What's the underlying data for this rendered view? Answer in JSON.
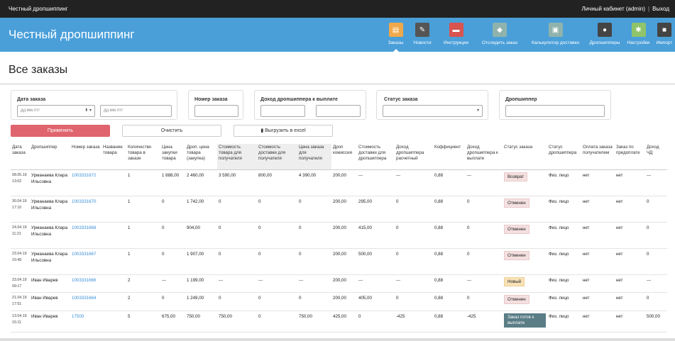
{
  "topbar": {
    "brand": "Честный дропшиппинг",
    "cabinet": "Личный кабинет (admin)",
    "separator": "|",
    "logout": "Выход"
  },
  "header": {
    "title": "Честный дропшиппинг"
  },
  "nav": [
    {
      "label": "Заказы",
      "icon": "orders-icon",
      "color": "#f0a94a",
      "glyph": "▤"
    },
    {
      "label": "Новости",
      "icon": "news-icon",
      "color": "#555555",
      "glyph": "✎"
    },
    {
      "label": "Инструкции",
      "icon": "instructions-icon",
      "color": "#d9534f",
      "glyph": "▬"
    },
    {
      "label": "Отследить заказ",
      "icon": "track-icon",
      "color": "#8fb3ac",
      "glyph": "◆"
    },
    {
      "label": "Калькулятор доставки",
      "icon": "calculator-icon",
      "color": "#8fb3ac",
      "glyph": "▣"
    },
    {
      "label": "Дропшипперы",
      "icon": "dropshippers-icon",
      "color": "#444444",
      "glyph": "●"
    },
    {
      "label": "Настройки",
      "icon": "settings-icon",
      "color": "#8fc46a",
      "glyph": "✱"
    },
    {
      "label": "Импорт",
      "icon": "import-icon",
      "color": "#444444",
      "glyph": "■"
    }
  ],
  "page_title": "Все заказы",
  "filters": {
    "date": {
      "label": "Дата заказа",
      "from_placeholder": "дд.мм.гггг",
      "to_placeholder": "дд.мм.гггг",
      "spin": "⬍ ▾"
    },
    "number": {
      "label": "Номер заказа"
    },
    "income": {
      "label": "Доход дропшиппера к выплате"
    },
    "status": {
      "label": "Статус заказа",
      "caret": "▾"
    },
    "dropshipper": {
      "label": "Дропшиппер"
    }
  },
  "buttons": {
    "apply": "Применить",
    "clear": "Очистить",
    "export": "Выгрузить в excel"
  },
  "columns": [
    "Дата заказа",
    "Дропшиппер",
    "Номер заказа",
    "Название товара",
    "Количество товара в заказе",
    "Цена закупки товара",
    "Дроп. цена товара (закупка)",
    "Стоимость товара для получателя",
    "Стоимость доставки для получателя",
    "Цена заказа для получателя",
    "Дроп комиссия",
    "Стоимость доставки для дропшиппера",
    "Доход дропшиппера расчетный",
    "Коффициент",
    "Доход дропшиппера к выплате",
    "Статус заказа",
    "Статус дропшиппера",
    "Оплата заказа получателем",
    "Заказ по предоплате",
    "Доход ЧД"
  ],
  "rows": [
    {
      "date": "08.05.19 13:02",
      "dropshipper": "Урманаева Клара Ильсовна",
      "number": "1003331672",
      "name": "",
      "qty": "1",
      "buy": "1 888,00",
      "drop_price": "2 460,00",
      "price_recipient": "3 590,00",
      "delivery_recipient": "800,00",
      "order_price": "4 390,00",
      "commission": "200,00",
      "delivery_drop": "---",
      "income_calc": "---",
      "coef": "0,88",
      "income_pay": "---",
      "status": "Возврат",
      "status_class": "b-return",
      "drop_status": "Физ. лицо",
      "paid": "нет",
      "prepaid": "нет",
      "income_hd": "---"
    },
    {
      "date": "30.04.19 17:10",
      "dropshipper": "Урманаева Клара Ильсовна",
      "number": "1003331670",
      "name": "",
      "qty": "1",
      "buy": "0",
      "drop_price": "1 742,00",
      "price_recipient": "0",
      "delivery_recipient": "0",
      "order_price": "0",
      "commission": "200,00",
      "delivery_drop": "295,00",
      "income_calc": "0",
      "coef": "0,88",
      "income_pay": "0",
      "status": "Отменен",
      "status_class": "b-cancel",
      "drop_status": "Физ. лицо",
      "paid": "нет",
      "prepaid": "нет",
      "income_hd": "0"
    },
    {
      "date": "24.04.19 11:21",
      "dropshipper": "Урманаева Клара Ильсовна",
      "number": "1003331668",
      "name": "",
      "qty": "1",
      "buy": "0",
      "drop_price": "904,00",
      "price_recipient": "0",
      "delivery_recipient": "0",
      "order_price": "0",
      "commission": "200,00",
      "delivery_drop": "415,00",
      "income_calc": "0",
      "coef": "0,88",
      "income_pay": "0",
      "status": "Отменен",
      "status_class": "b-cancel",
      "drop_status": "Физ. лицо",
      "paid": "нет",
      "prepaid": "нет",
      "income_hd": "0"
    },
    {
      "date": "23.04.19 15:49",
      "dropshipper": "Урманаева Клара Ильсовна",
      "number": "1003331667",
      "name": "",
      "qty": "1",
      "buy": "0",
      "drop_price": "1 907,00",
      "price_recipient": "0",
      "delivery_recipient": "0",
      "order_price": "0",
      "commission": "200,00",
      "delivery_drop": "500,00",
      "income_calc": "0",
      "coef": "0,88",
      "income_pay": "0",
      "status": "Отменен",
      "status_class": "b-cancel",
      "drop_status": "Физ. лицо",
      "paid": "нет",
      "prepaid": "нет",
      "income_hd": "0"
    },
    {
      "date": "23.04.19 09:17",
      "dropshipper": "Иван Иварев",
      "number": "1003331666",
      "name": "",
      "qty": "2",
      "buy": "---",
      "drop_price": "1 199,00",
      "price_recipient": "---",
      "delivery_recipient": "---",
      "order_price": "---",
      "commission": "200,00",
      "delivery_drop": "---",
      "income_calc": "---",
      "coef": "0,88",
      "income_pay": "---",
      "status": "Новый",
      "status_class": "b-new",
      "drop_status": "Физ. лицо",
      "paid": "нет",
      "prepaid": "нет",
      "income_hd": "---"
    },
    {
      "date": "21.04.19 17:51",
      "dropshipper": "Иван Иварев",
      "number": "1003331664",
      "name": "",
      "qty": "2",
      "buy": "0",
      "drop_price": "1 249,00",
      "price_recipient": "0",
      "delivery_recipient": "0",
      "order_price": "0",
      "commission": "200,00",
      "delivery_drop": "405,00",
      "income_calc": "0",
      "coef": "0,88",
      "income_pay": "0",
      "status": "Отменен",
      "status_class": "b-cancel",
      "drop_status": "Физ. лицо",
      "paid": "нет",
      "prepaid": "нет",
      "income_hd": "0"
    },
    {
      "date": "13.04.19 15:11",
      "dropshipper": "Иван Иварев",
      "number": "17500",
      "name": "",
      "qty": "5",
      "buy": "675,00",
      "drop_price": "750,00",
      "price_recipient": "750,00",
      "delivery_recipient": "0",
      "order_price": "750,00",
      "commission": "425,00",
      "delivery_drop": "0",
      "income_calc": "-425",
      "coef": "0,88",
      "income_pay": "-425",
      "status": "Заказ готов к выплате",
      "status_class": "b-ready",
      "drop_status": "Физ. лицо",
      "paid": "нет",
      "prepaid": "нет",
      "income_hd": "500,00"
    }
  ]
}
